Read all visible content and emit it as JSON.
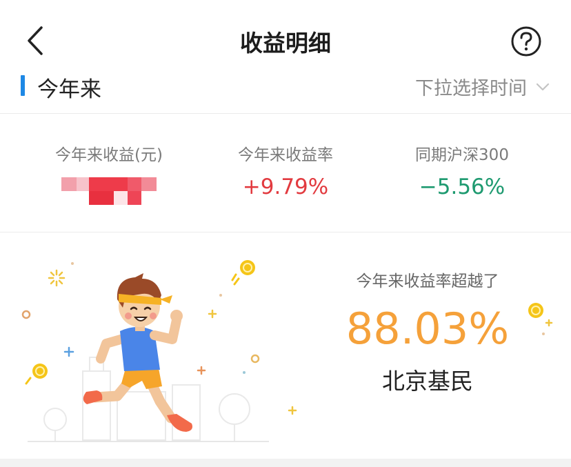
{
  "header": {
    "title": "收益明细",
    "back_icon": "chevron-left-icon",
    "help_icon": "question-circle-icon"
  },
  "period": {
    "label": "今年来",
    "select_placeholder": "下拉选择时间",
    "select_icon": "chevron-down-icon",
    "accent_color": "#1e88e5"
  },
  "stats": [
    {
      "label": "今年来收益(元)",
      "value": "",
      "value_hidden": true
    },
    {
      "label": "今年来收益率",
      "value": "+9.79%",
      "color": "#e23a3f"
    },
    {
      "label": "同期沪深300",
      "value": "−5.56%",
      "color": "#1e9a70"
    }
  ],
  "beat": {
    "caption": "今年来收益率超越了",
    "percent": "88.03%",
    "who": "北京基民",
    "color": "#f5a13a"
  },
  "illustration": {
    "icon": "running-man-icon"
  }
}
